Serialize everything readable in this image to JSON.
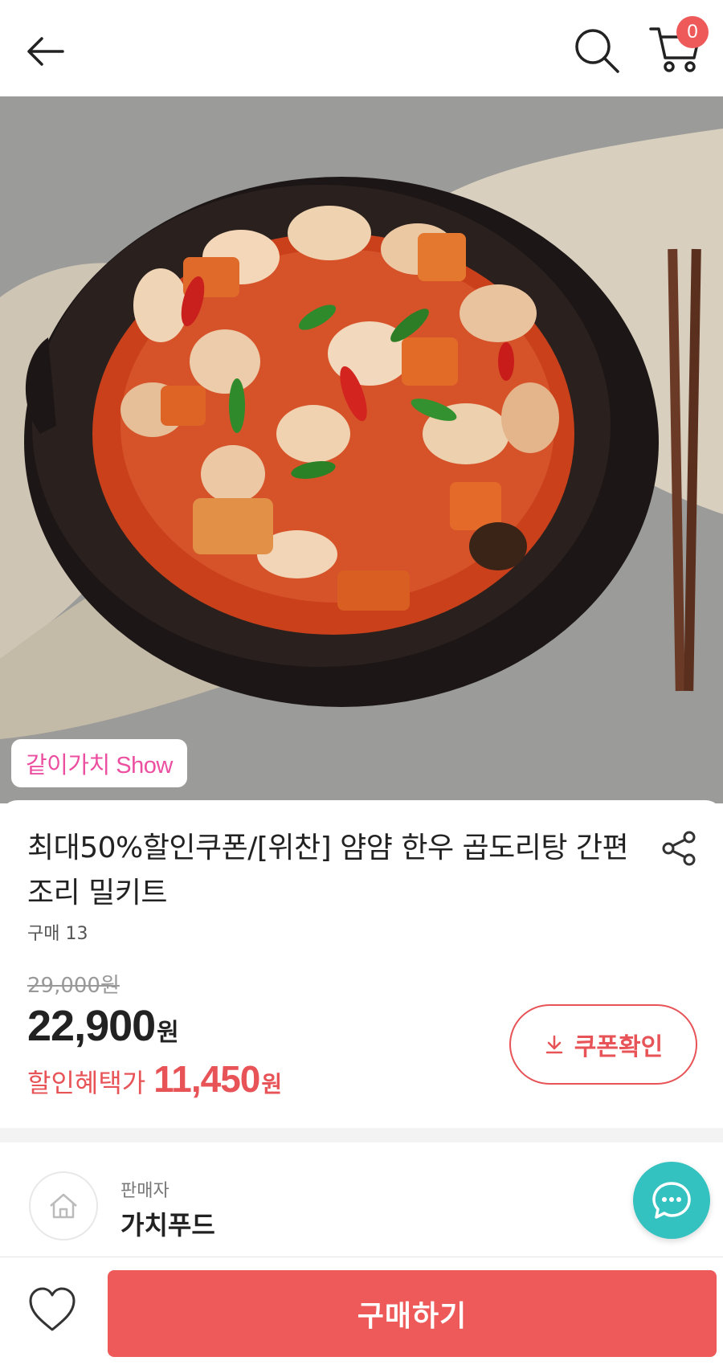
{
  "header": {
    "back_icon": "arrow-left-icon",
    "search_icon": "search-icon",
    "cart_icon": "cart-icon",
    "cart_count": "0"
  },
  "hero": {
    "badge": "같이가치 Show"
  },
  "product": {
    "title": "최대50%할인쿠폰/[위찬] 얌얌 한우 곱도리탕 간편조리 밀키트",
    "purchases": "구매 13",
    "original_price": "29,000원",
    "price": "22,900",
    "price_unit": "원",
    "discount_label": "할인혜택가",
    "discount_price": "11,450",
    "discount_unit": "원",
    "coupon_button": "쿠폰확인"
  },
  "seller": {
    "label": "판매자",
    "name": "가치푸드"
  },
  "bottom": {
    "buy_button": "구매하기"
  },
  "colors": {
    "accent": "#ee5a5a",
    "discount": "#e75356",
    "chat": "#34c2c0",
    "badge_text": "#ec4fa0"
  }
}
